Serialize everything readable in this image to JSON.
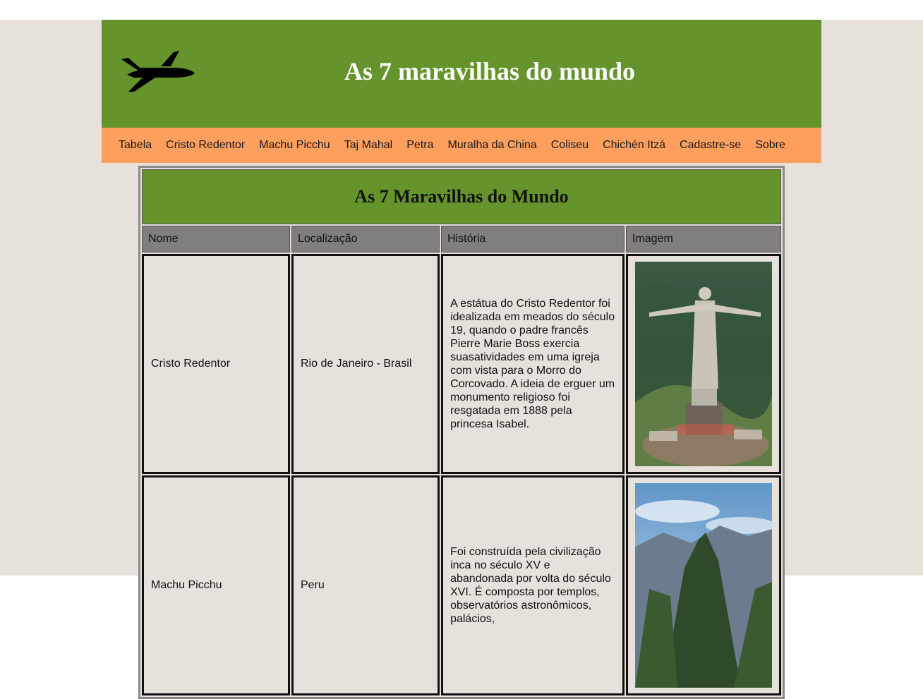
{
  "header": {
    "title": "As 7 maravilhas do mundo",
    "logo_icon": "airplane-icon",
    "bg_color": "#65932c"
  },
  "nav": {
    "bg_color": "#fe9f5e",
    "items": [
      {
        "label": "Tabela"
      },
      {
        "label": "Cristo Redentor"
      },
      {
        "label": "Machu Picchu"
      },
      {
        "label": "Taj Mahal"
      },
      {
        "label": "Petra"
      },
      {
        "label": "Muralha da China"
      },
      {
        "label": "Coliseu"
      },
      {
        "label": "Chichén Itzá"
      },
      {
        "label": "Cadastre-se"
      },
      {
        "label": "Sobre"
      }
    ]
  },
  "table": {
    "caption": "As 7 Maravilhas do Mundo",
    "headers": [
      "Nome",
      "Localização",
      "História",
      "Imagem"
    ],
    "rows": [
      {
        "nome": "Cristo Redentor",
        "localizacao": "Rio de Janeiro - Brasil",
        "historia": "A estátua do Cristo Redentor foi idealizada em meados do século 19, quando o padre francês Pierre Marie Boss exercia suasatividades em uma igreja com vista para o Morro do Corcovado. A ideia de erguer um monumento religioso foi resgatada em 1888 pela princesa Isabel.",
        "image_icon": "cristo-redentor-photo"
      },
      {
        "nome": "Machu Picchu",
        "localizacao": "Peru",
        "historia": "Foi construída pela civilização inca no século XV e abandonada por volta do século XVI. É composta por templos, observatórios astronômicos, palácios,",
        "image_icon": "machu-picchu-photo"
      }
    ]
  }
}
